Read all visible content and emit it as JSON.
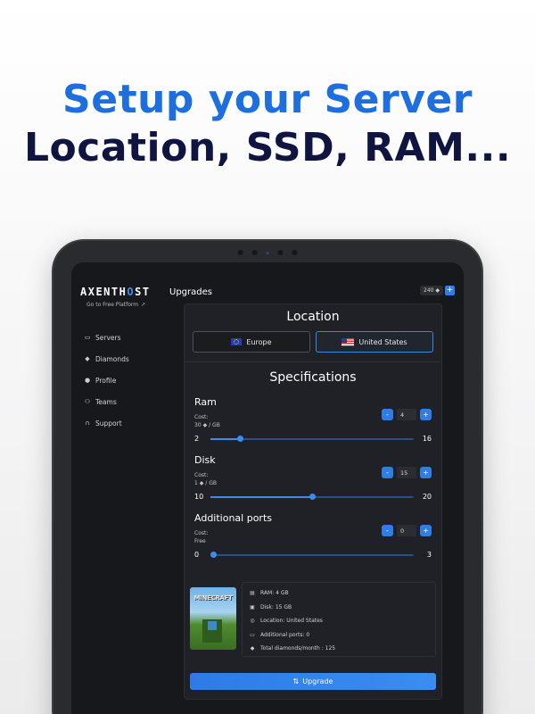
{
  "headline": {
    "line1": "Setup your Server",
    "line2": "Location, SSD, RAM..."
  },
  "app": {
    "logo_main": "AXENTH",
    "logo_accent": "O",
    "logo_end": "ST",
    "free_platform_link": "Go to Free Platform",
    "page_title": "Upgrades",
    "balance": "240",
    "balance_add": "+"
  },
  "sidebar": {
    "items": [
      {
        "label": "Servers",
        "icon": "server-icon"
      },
      {
        "label": "Diamonds",
        "icon": "diamond-icon"
      },
      {
        "label": "Profile",
        "icon": "user-icon"
      },
      {
        "label": "Teams",
        "icon": "team-icon"
      },
      {
        "label": "Support",
        "icon": "headset-icon"
      }
    ]
  },
  "location": {
    "title": "Location",
    "options": [
      {
        "label": "Europe",
        "selected": false
      },
      {
        "label": "United States",
        "selected": true
      }
    ]
  },
  "specifications": {
    "title": "Specifications",
    "ram": {
      "name": "Ram",
      "cost_label": "Cost:",
      "cost": "30",
      "cost_unit": "/ GB",
      "value": "4",
      "min": "2",
      "max": "16",
      "decrement": "-",
      "increment": "+"
    },
    "disk": {
      "name": "Disk",
      "cost_label": "Cost:",
      "cost": "1",
      "cost_unit": "/ GB",
      "value": "15",
      "min": "10",
      "max": "20",
      "decrement": "-",
      "increment": "+"
    },
    "ports": {
      "name": "Additional ports",
      "cost_label": "Cost:",
      "cost": "Free",
      "value": "0",
      "min": "0",
      "max": "3",
      "decrement": "-",
      "increment": "+"
    }
  },
  "summary": {
    "image_text": "MINECRAFT",
    "ram": "RAM: 4 GB",
    "disk": "Disk: 15 GB",
    "location": "Location: United States",
    "ports": "Additional ports: 0",
    "total": "Total diamonds/month : 125"
  },
  "upgrade_button": "Upgrade",
  "colors": {
    "accent": "#2f7ee6",
    "headline_blue": "#1d6fe0",
    "headline_navy": "#0f1540",
    "screen_bg": "#17181b"
  }
}
